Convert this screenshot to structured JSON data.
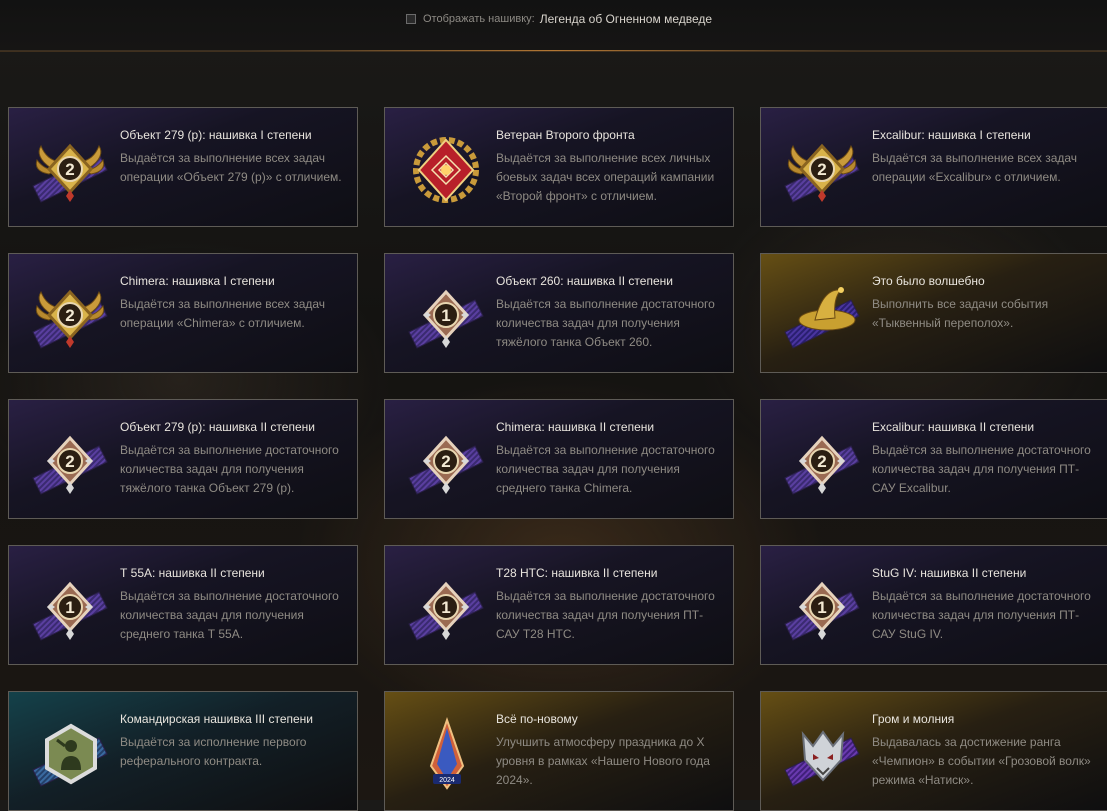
{
  "display_toggle": {
    "label": "Отображать нашивку:",
    "value": "Легенда об Огненном медведе",
    "checked": false
  },
  "colors": {
    "accent_gold": "#c9a24a",
    "card_border": "#5e5b56",
    "title_text": "#e9e5de",
    "desc_text": "#8f8b84"
  },
  "badges": [
    {
      "title": "Объект 279 (р): нашивка I степени",
      "description": "Выдаётся за выполнение всех задач операции «Объект 279 (р)» с отличием.",
      "icon": "gold-diamond-2-winged-icon",
      "theme": "purple"
    },
    {
      "title": "Ветеран Второго фронта",
      "description": "Выдаётся за выполнение всех личных боевых задач всех операций кампании «Второй фронт» с отличием.",
      "icon": "red-grid-laurel-emblem-icon",
      "theme": "purple"
    },
    {
      "title": "Excalibur: нашивка I степени",
      "description": "Выдаётся за выполнение всех задач операции «Excalibur» с отличием.",
      "icon": "gold-diamond-2-winged-icon",
      "theme": "purple"
    },
    {
      "title": "Chimera: нашивка I степени",
      "description": "Выдаётся за выполнение всех задач операции «Chimera» с отличием.",
      "icon": "gold-diamond-2-winged-icon",
      "theme": "purple"
    },
    {
      "title": "Объект 260: нашивка II степени",
      "description": "Выдаётся за выполнение достаточного количества задач для получения тяжёлого танка Объект 260.",
      "icon": "bronze-diamond-1-icon",
      "theme": "purple"
    },
    {
      "title": "Это было волшебно",
      "description": "Выполнить все задачи события «Тыквенный переполох».",
      "icon": "witch-hat-icon",
      "theme": "gold"
    },
    {
      "title": "Объект 279 (р): нашивка II степени",
      "description": "Выдаётся за выполнение достаточного количества задач для получения тяжёлого танка Объект 279 (р).",
      "icon": "bronze-diamond-2-icon",
      "theme": "purple"
    },
    {
      "title": "Chimera: нашивка II степени",
      "description": "Выдаётся за выполнение достаточного количества задач для получения среднего танка Chimera.",
      "icon": "bronze-diamond-2-icon",
      "theme": "purple"
    },
    {
      "title": "Excalibur: нашивка II степени",
      "description": "Выдаётся за выполнение достаточного количества задач для получения ПТ-САУ Excalibur.",
      "icon": "bronze-diamond-2-icon",
      "theme": "purple"
    },
    {
      "title": "Т 55А: нашивка II степени",
      "description": "Выдаётся за выполнение достаточного количества задач для получения среднего танка Т 55А.",
      "icon": "bronze-diamond-1-icon",
      "theme": "purple"
    },
    {
      "title": "T28 HTC: нашивка II степени",
      "description": "Выдаётся за выполнение достаточного количества задач для получения ПТ-САУ T28 HTC.",
      "icon": "bronze-diamond-1-icon",
      "theme": "purple"
    },
    {
      "title": "StuG IV: нашивка II степени",
      "description": "Выдаётся за выполнение достаточного количества задач для получения ПТ-САУ StuG IV.",
      "icon": "bronze-diamond-1-icon",
      "theme": "purple"
    },
    {
      "title": "Командирская нашивка III степени",
      "description": "Выдаётся за исполнение первого реферального контракта.",
      "icon": "soldier-salute-hexagon-icon",
      "theme": "teal"
    },
    {
      "title": "Всё по-новому",
      "description": "Улучшить атмосферу праздника до X уровня в рамках «Нашего Нового года 2024».",
      "icon": "new-year-2024-crystal-icon",
      "theme": "gold"
    },
    {
      "title": "Гром и молния",
      "description": "Выдавалась за достижение ранга «Чемпион» в событии «Грозовой волк» режима «Натиск».",
      "icon": "silver-wolf-head-icon",
      "theme": "gold"
    }
  ]
}
